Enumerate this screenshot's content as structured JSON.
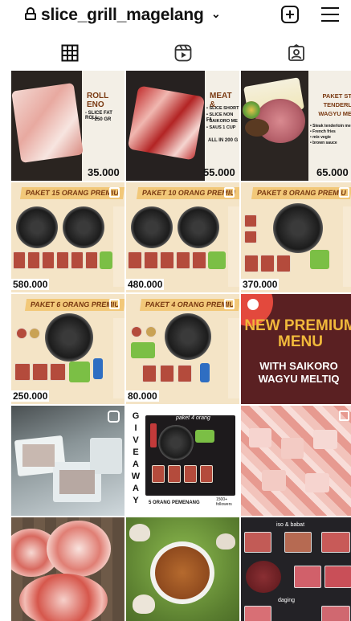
{
  "header": {
    "username": "slice_grill_magelang",
    "chevron": "⌄",
    "lock_icon": "lock-icon",
    "create_icon": "plus-square-icon",
    "menu_icon": "hamburger-menu-icon"
  },
  "tabs": [
    {
      "name": "posts-grid",
      "icon": "grid-icon",
      "active": true
    },
    {
      "name": "reels",
      "icon": "reels-icon",
      "active": false
    },
    {
      "name": "tagged",
      "icon": "tagged-person-icon",
      "active": false
    }
  ],
  "posts": [
    {
      "banner": "ROLL ENO",
      "price": "35.000",
      "lines": [
        "- SLICE FAT ROLL",
        "- 250 GR"
      ]
    },
    {
      "banner": "MEAT &",
      "price": "55.000",
      "lines": [
        "• SLICE SHORT",
        "• SLICE NON FA",
        "• SAIKORO ME",
        "• SAUS 1 CUP",
        "ALL IN 200 G"
      ]
    },
    {
      "banner": "PAKET ST TENDERL WAGYU ME",
      "price": "65.000",
      "lines": [
        "• Steak tenderloin me",
        "• French fries",
        "• mix vegie",
        "• brown sauce"
      ]
    },
    {
      "banner": "PAKET 15 ORANG PREMIU",
      "price": "580.000"
    },
    {
      "banner": "PAKET 10 ORANG PREMIU",
      "price": "480.000"
    },
    {
      "banner": "PAKET 8 ORANG PREMIU",
      "price": "370.000"
    },
    {
      "banner": "PAKET 6 ORANG PREMIU",
      "price": "250.000"
    },
    {
      "banner": "PAKET 4 ORANG PREMIU",
      "price": "80.000"
    },
    {
      "headline": "NEW PREMIUM MENU",
      "subline": "WITH SAIKORO WAGYU MELTIQ"
    },
    {
      "type": "reel"
    },
    {
      "giveaway_letters": [
        "G",
        "I",
        "V",
        "E",
        "A",
        "W",
        "A",
        "Y"
      ],
      "note": "paket 4 orang",
      "footer": "5 ORANG PEMENANG",
      "followers": "1500+ followers"
    },
    {
      "type": "carousel"
    },
    {
      "type": "photo"
    },
    {
      "type": "photo"
    },
    {
      "labels": [
        "iso & babat",
        "daging"
      ]
    }
  ]
}
